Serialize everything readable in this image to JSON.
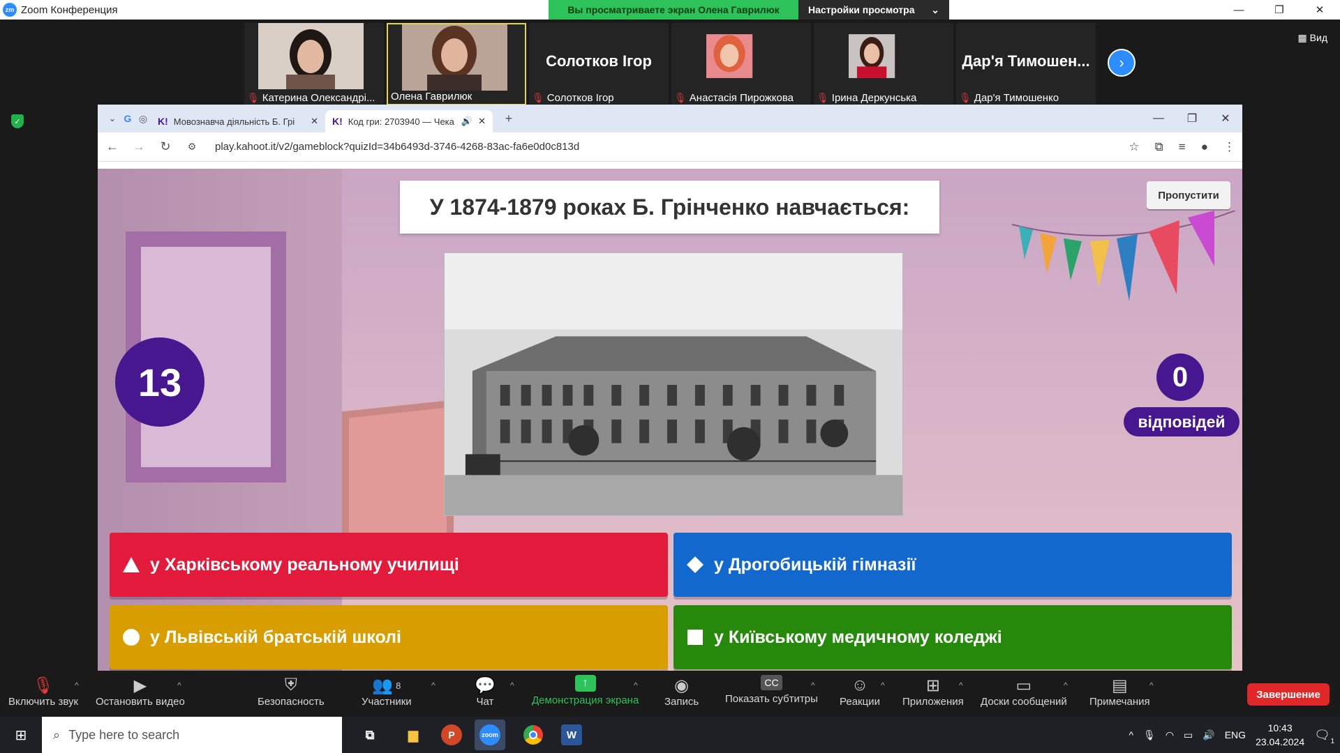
{
  "zoom": {
    "title": "Zoom Конференция",
    "share_banner": "Вы просматриваете экран Олена Гаврилюк",
    "view_settings": "Настройки просмотра",
    "view_button": "Вид"
  },
  "participants": [
    {
      "name": "Катерина Олександрі...",
      "has_video": true,
      "muted": true,
      "active": false
    },
    {
      "name": "Олена Гаврилюк",
      "has_video": true,
      "muted": false,
      "active": true
    },
    {
      "name": "Солотков Ігор",
      "display_name": "Солотков Ігор",
      "has_video": false,
      "muted": true,
      "active": false
    },
    {
      "name": "Анастасія Пирожкова",
      "has_video": true,
      "muted": true,
      "active": false
    },
    {
      "name": "Ірина Деркунська",
      "has_video": true,
      "muted": true,
      "active": false
    },
    {
      "name": "Дар'я Тимошенко",
      "display_name": "Дар'я Тимошен...",
      "has_video": false,
      "muted": true,
      "active": false
    }
  ],
  "browser": {
    "tabs": [
      {
        "label": "Мовознавча діяльність Б. Грі",
        "active": false
      },
      {
        "label": "Код гри: 2703940 — Чека",
        "active": true
      }
    ],
    "url": "play.kahoot.it/v2/gameblock?quizId=34b6493d-3746-4268-83ac-fa6e0d0c813d"
  },
  "kahoot": {
    "question": "У 1874-1879 роках Б. Грінченко навчається:",
    "skip_label": "Пропустити",
    "timer": "13",
    "answers_count": "0",
    "answers_label": "відповідей",
    "answers": [
      {
        "text": "у Харківському реальному училищі",
        "shape": "triangle",
        "color": "#e21b3c"
      },
      {
        "text": "у Дрогобицькій гімназії",
        "shape": "diamond",
        "color": "#1368ce"
      },
      {
        "text": "у Львівській братській школі",
        "shape": "circle",
        "color": "#d89e00"
      },
      {
        "text": "у Київському медичному коледжі",
        "shape": "square",
        "color": "#26890c"
      }
    ]
  },
  "toolbar": {
    "unmute": "Включить звук",
    "stop_video": "Остановить видео",
    "security": "Безопасность",
    "participants": "Участники",
    "participants_count": "8",
    "chat": "Чат",
    "share_screen": "Демонстрация экрана",
    "record": "Запись",
    "captions": "Показать субтитры",
    "reactions": "Реакции",
    "apps": "Приложения",
    "whiteboards": "Доски сообщений",
    "notes": "Примечания",
    "end": "Завершение"
  },
  "taskbar": {
    "search_placeholder": "Type here to search",
    "lang": "ENG",
    "time": "10:43",
    "date": "23.04.2024",
    "notif_count": "1"
  }
}
